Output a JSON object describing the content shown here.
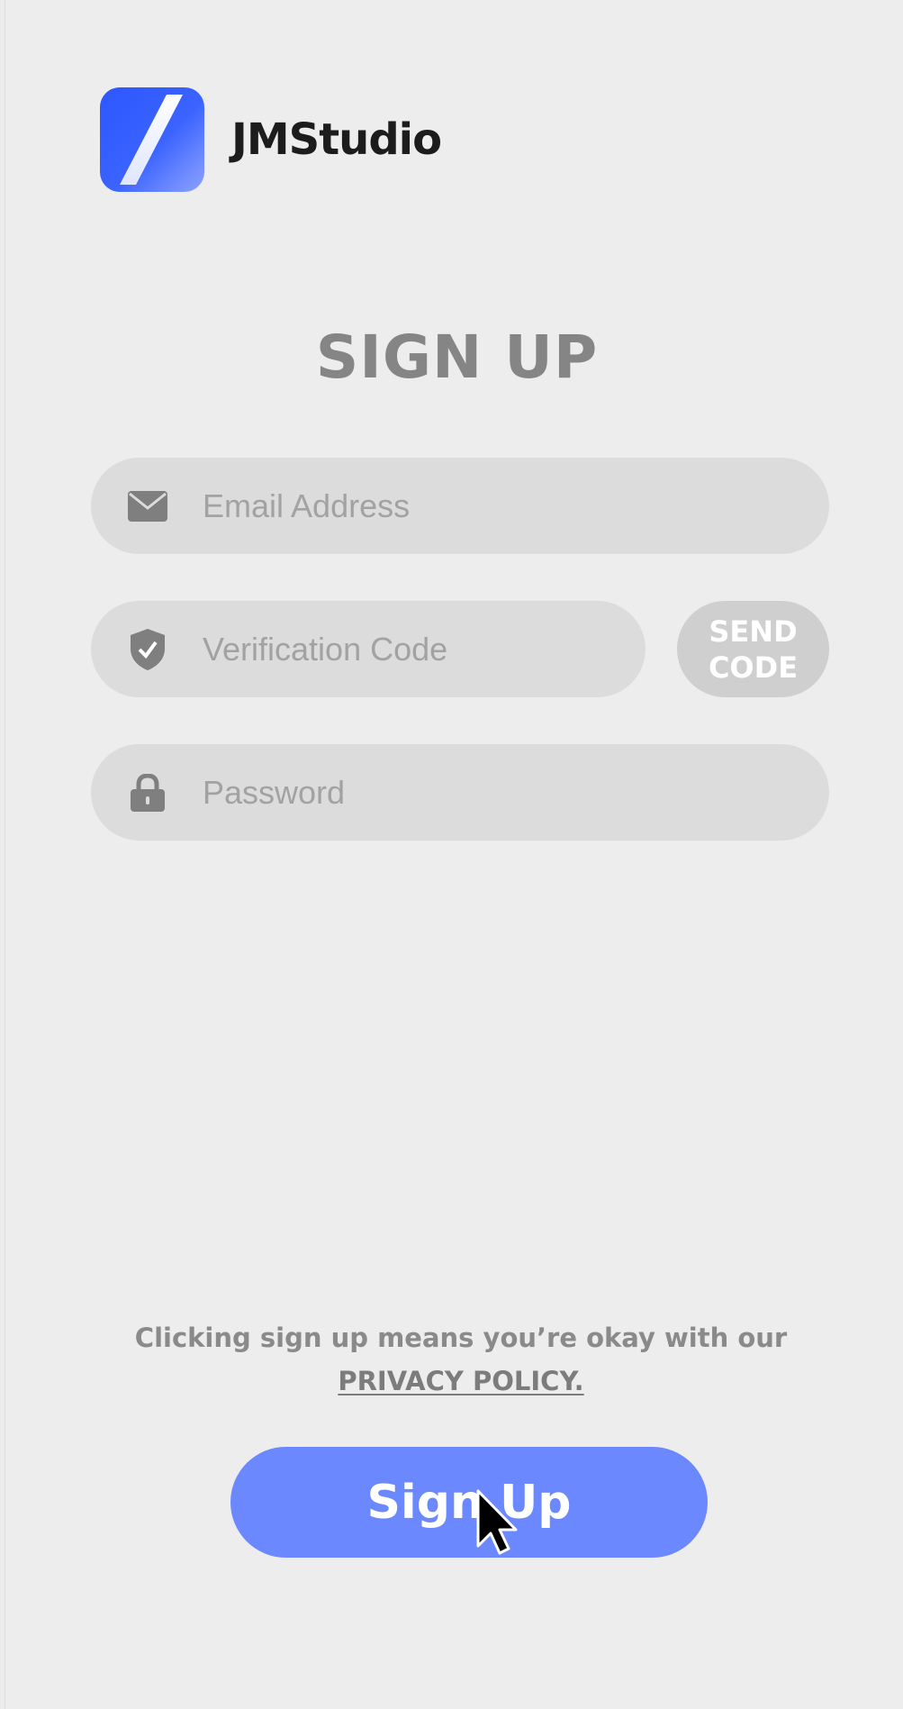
{
  "brand": {
    "name": "JMStudio",
    "colors": {
      "logo_top": "#2f5cff",
      "logo_bottom": "#6d8bff"
    }
  },
  "title": "SIGN UP",
  "form": {
    "email": {
      "placeholder": "Email Address",
      "value": "",
      "icon": "envelope-icon"
    },
    "verification": {
      "placeholder": "Verification Code",
      "value": "",
      "icon": "shield-check-icon"
    },
    "send_code_label": "SEND\nCODE",
    "password": {
      "placeholder": "Password",
      "value": "",
      "icon": "lock-icon"
    }
  },
  "consent": {
    "text": "Clicking sign up means you’re okay with our",
    "link": "PRIVACY POLICY."
  },
  "signup_label": "Sign Up",
  "colors": {
    "background": "#ededee",
    "field": "#dcdcdd",
    "accent": "#6b88ff",
    "send_code_bg": "#cfcfd0"
  }
}
